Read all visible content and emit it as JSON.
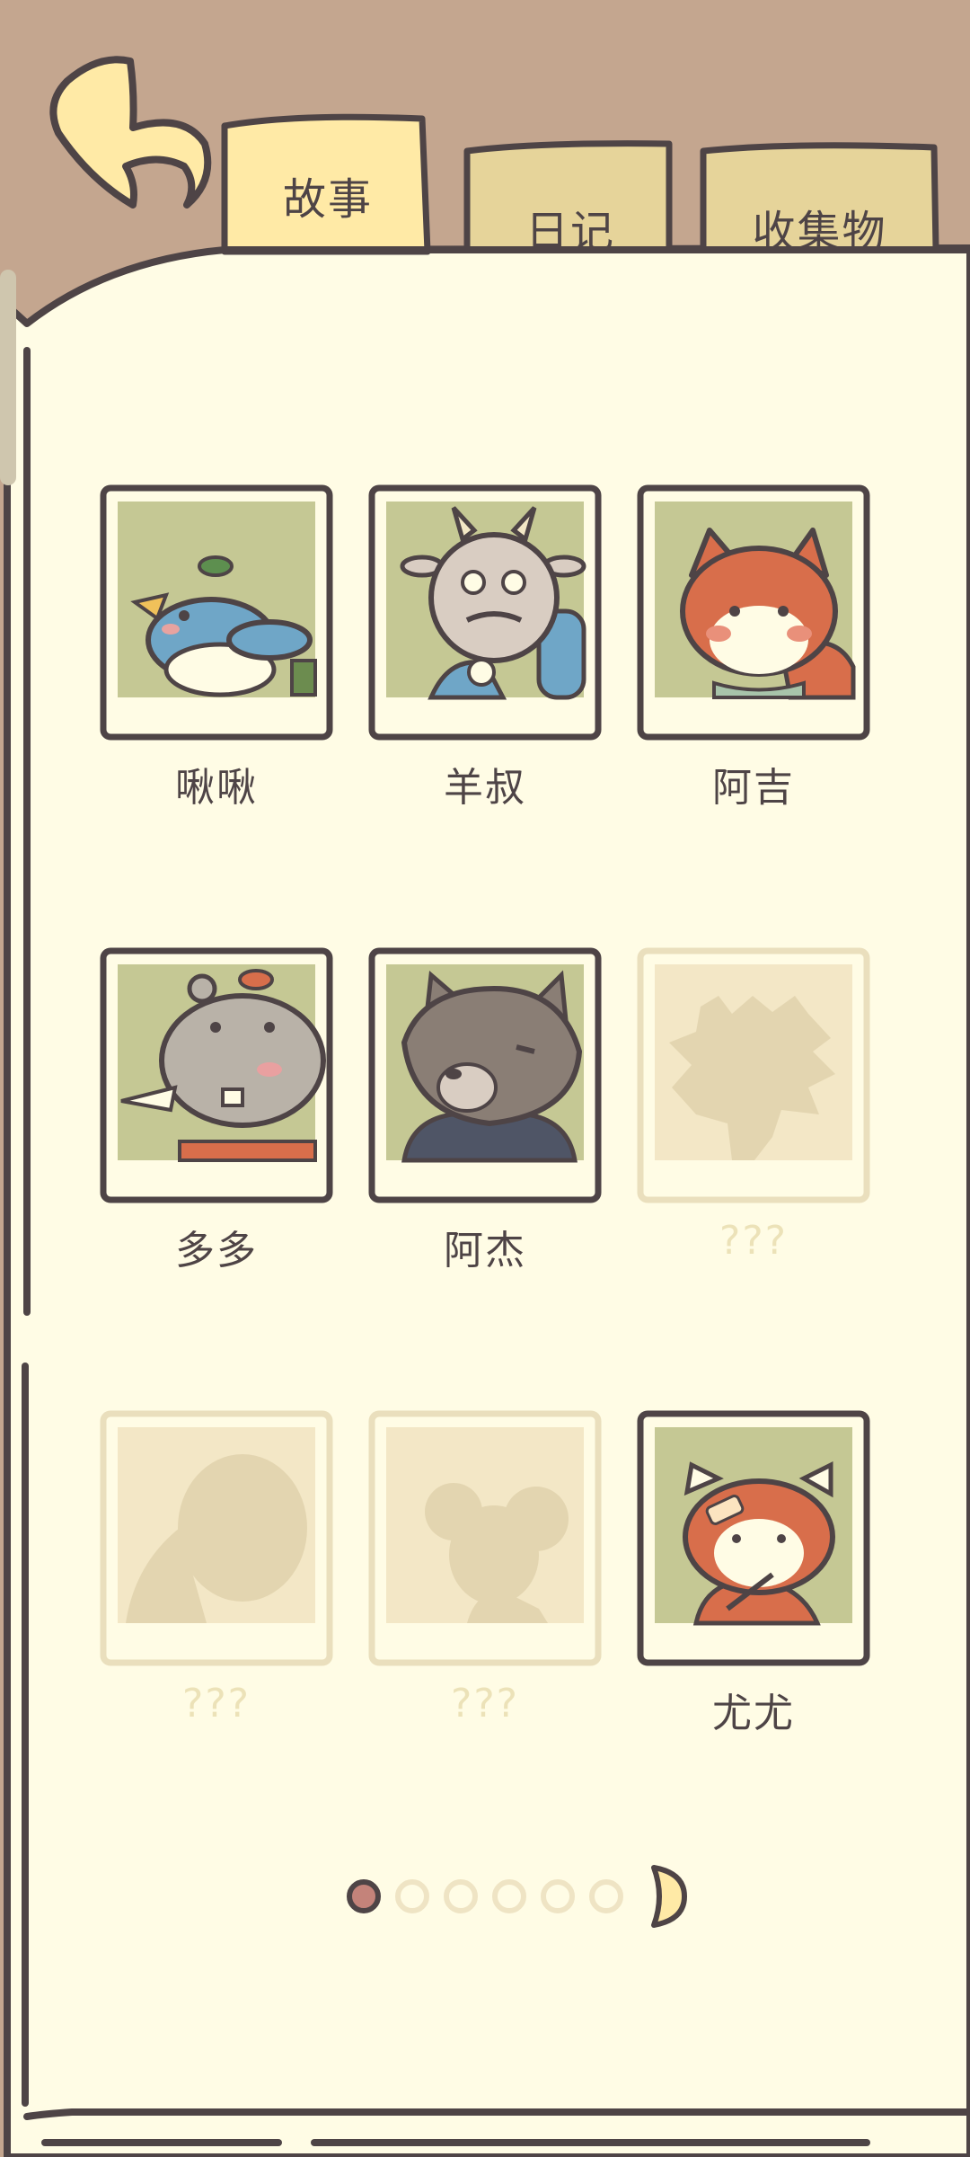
{
  "tabs": [
    {
      "label": "故事",
      "active": true
    },
    {
      "label": "日记",
      "active": false
    },
    {
      "label": "收集物",
      "active": false
    }
  ],
  "characters": [
    {
      "name": "啾啾",
      "locked": false,
      "icon": "bird-portrait"
    },
    {
      "name": "羊叔",
      "locked": false,
      "icon": "goat-portrait"
    },
    {
      "name": "阿吉",
      "locked": false,
      "icon": "fox-portrait"
    },
    {
      "name": "多多",
      "locked": false,
      "icon": "hippo-portrait"
    },
    {
      "name": "阿杰",
      "locked": false,
      "icon": "wolf-portrait"
    },
    {
      "name": "???",
      "locked": true,
      "icon": "locked-silhouette"
    },
    {
      "name": "???",
      "locked": true,
      "icon": "locked-silhouette"
    },
    {
      "name": "???",
      "locked": true,
      "icon": "locked-silhouette"
    },
    {
      "name": "尤尤",
      "locked": false,
      "icon": "red-panda-portrait"
    }
  ],
  "pagination": {
    "total_pages": 6,
    "current_page": 1
  },
  "colors": {
    "background": "#c4a68f",
    "paper": "#fffce5",
    "ink": "#4e4446",
    "tab_active": "#ffeaa6",
    "tab_inactive": "#e6d49a",
    "photo_bg": "#c5c894",
    "locked_frame": "#eadfbd",
    "locked_bg": "#f3e7c6",
    "locked_silhouette": "#e3d5b0",
    "page_dot_active": "#c4837a"
  }
}
